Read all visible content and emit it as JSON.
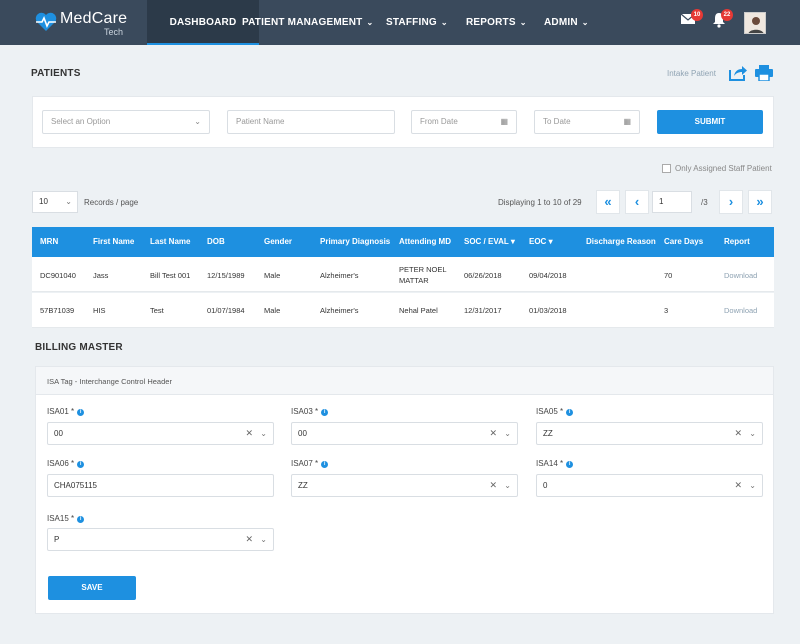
{
  "app": {
    "brand_name": "MedCare",
    "brand_sub": "Tech"
  },
  "nav": {
    "items": [
      {
        "label": "DASHBOARD",
        "active": true
      },
      {
        "label": "PATIENT MANAGEMENT",
        "has_dropdown": true
      },
      {
        "label": "STAFFING",
        "has_dropdown": true
      },
      {
        "label": "REPORTS",
        "has_dropdown": true
      },
      {
        "label": "ADMIN",
        "has_dropdown": true
      }
    ],
    "mail_count": "10",
    "notification_count": "22"
  },
  "patients": {
    "title": "PATIENTS",
    "intake_link": "Intake Patient",
    "filters": {
      "select_placeholder": "Select an Option",
      "name_placeholder": "Patient Name",
      "from_placeholder": "From Date",
      "to_placeholder": "To Date",
      "submit_label": "SUBMIT"
    },
    "only_assigned_label": "Only Assigned Staff Patient",
    "page_size": "10",
    "records_per_page": "Records / page",
    "displaying": "Displaying 1 to 10 of 29",
    "current_page": "1",
    "total_pages": "/3",
    "columns": [
      "MRN",
      "First Name",
      "Last Name",
      "DOB",
      "Gender",
      "Primary Diagnosis",
      "Attending MD",
      "SOC / EVAL",
      "EOC",
      "Discharge Reason",
      "Care Days",
      "Report"
    ],
    "rows": [
      {
        "mrn": "DC901040",
        "first": "Jass",
        "last": "Bill Test 001",
        "dob": "12/15/1989",
        "gender": "Male",
        "diagnosis": "Alzheimer's",
        "md_line1": "PETER NOEL",
        "md_line2": "MATTAR",
        "soc": "06/26/2018",
        "eoc": "09/04/2018",
        "discharge": "",
        "care_days": "70",
        "report": "Download"
      },
      {
        "mrn": "57B71039",
        "first": "HIS",
        "last": "Test",
        "dob": "01/07/1984",
        "gender": "Male",
        "diagnosis": "Alzheimer's",
        "md_line1": "Nehal Patel",
        "md_line2": "",
        "soc": "12/31/2017",
        "eoc": "01/03/2018",
        "discharge": "",
        "care_days": "3",
        "report": "Download"
      }
    ]
  },
  "billing": {
    "title": "BILLING MASTER",
    "subheader": "ISA Tag - Interchange Control Header",
    "fields": {
      "isa01": {
        "label": "ISA01 *",
        "value": "00"
      },
      "isa03": {
        "label": "ISA03 *",
        "value": "00"
      },
      "isa05": {
        "label": "ISA05 *",
        "value": "ZZ"
      },
      "isa06": {
        "label": "ISA06 *",
        "value": "CHA075115"
      },
      "isa07": {
        "label": "ISA07 *",
        "value": "ZZ"
      },
      "isa14": {
        "label": "ISA14 *",
        "value": "0"
      },
      "isa15": {
        "label": "ISA15 *",
        "value": "P"
      }
    },
    "save_label": "SAVE"
  },
  "colors": {
    "nav_bg": "#3a4a5c",
    "accent": "#1e90e0",
    "badge": "#e53935",
    "page_bg": "#edf1f4"
  }
}
